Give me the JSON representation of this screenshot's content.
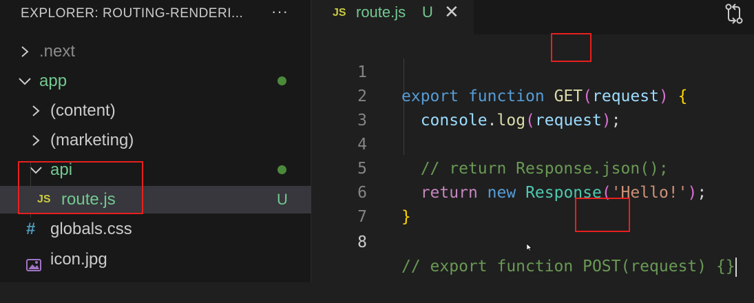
{
  "explorer": {
    "header": "EXPLORER: ROUTING-RENDERI...",
    "more": "···",
    "items": [
      {
        "label": ".next",
        "type": "folder",
        "expanded": false
      },
      {
        "label": "app",
        "type": "folder",
        "expanded": true
      },
      {
        "label": "(content)",
        "type": "folder",
        "expanded": false
      },
      {
        "label": "(marketing)",
        "type": "folder",
        "expanded": false
      },
      {
        "label": "api",
        "type": "folder",
        "expanded": true
      },
      {
        "label": "route.js",
        "type": "js",
        "status": "U",
        "selected": true
      },
      {
        "label": "globals.css",
        "type": "css"
      },
      {
        "label": "icon.jpg",
        "type": "image"
      }
    ],
    "js_badge": "JS",
    "css_badge": "#"
  },
  "tab": {
    "badge": "JS",
    "label": "route.js",
    "status": "U",
    "close": "✕"
  },
  "code": {
    "lines": [
      {
        "n": "1",
        "text": "export function GET(request) {"
      },
      {
        "n": "2",
        "text": "  console.log(request);"
      },
      {
        "n": "3",
        "text": ""
      },
      {
        "n": "4",
        "text": "  // return Response.json();"
      },
      {
        "n": "5",
        "text": "  return new Response('Hello!');"
      },
      {
        "n": "6",
        "text": "}"
      },
      {
        "n": "7",
        "text": ""
      },
      {
        "n": "8",
        "text": "// export function POST(request) {}"
      }
    ],
    "tokens": {
      "export": "export",
      "function": "function",
      "get": "GET",
      "request": "request",
      "open_paren": "(",
      "close_paren": ")",
      "open_brace": "{",
      "close_brace": "}",
      "console": "console",
      "dot": ".",
      "log": "log",
      "semicolon": ";",
      "comment4": "// return Response.json();",
      "return": "return",
      "new": "new",
      "Response": "Response",
      "hello": "'Hello!'",
      "comment8": "// export function POST(request) {}"
    }
  },
  "colors": {
    "keyword": "#569cd6",
    "function": "#dcdcaa",
    "variable": "#9cdcfe",
    "comment": "#6a9955",
    "string": "#ce9178",
    "class": "#4ec9b0",
    "git_untracked": "#73c991",
    "annotation": "#e8201f"
  }
}
